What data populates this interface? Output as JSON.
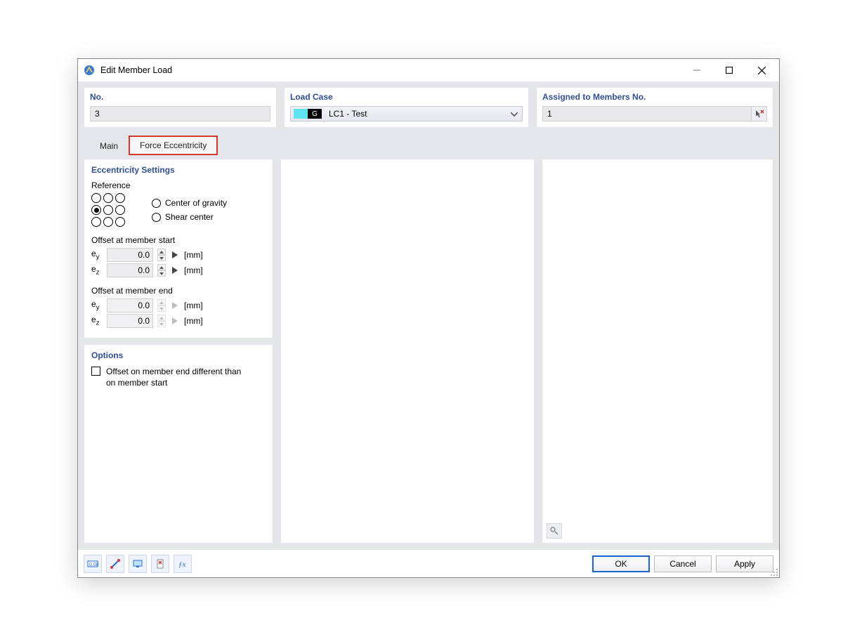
{
  "window": {
    "title": "Edit Member Load"
  },
  "top": {
    "no_label": "No.",
    "no_value": "3",
    "lc_label": "Load Case",
    "lc_badge": "G",
    "lc_text": "LC1 - Test",
    "assign_label": "Assigned to Members No.",
    "assign_value": "1"
  },
  "tabs": {
    "main": "Main",
    "force_ecc": "Force Eccentricity"
  },
  "ecc": {
    "title": "Eccentricity Settings",
    "reference_label": "Reference",
    "center_gravity": "Center of gravity",
    "shear_center": "Shear center",
    "offset_start_label": "Offset at member start",
    "offset_end_label": "Offset at member end",
    "ey_label_pre": "e",
    "ey_label_sub": "y",
    "ez_label_pre": "e",
    "ez_label_sub": "z",
    "start_ey": "0.0",
    "start_ez": "0.0",
    "end_ey": "0.0",
    "end_ez": "0.0",
    "unit": "[mm]"
  },
  "options": {
    "title": "Options",
    "diff_offset": "Offset on member end different than on member start"
  },
  "footer": {
    "ok": "OK",
    "cancel": "Cancel",
    "apply": "Apply"
  }
}
